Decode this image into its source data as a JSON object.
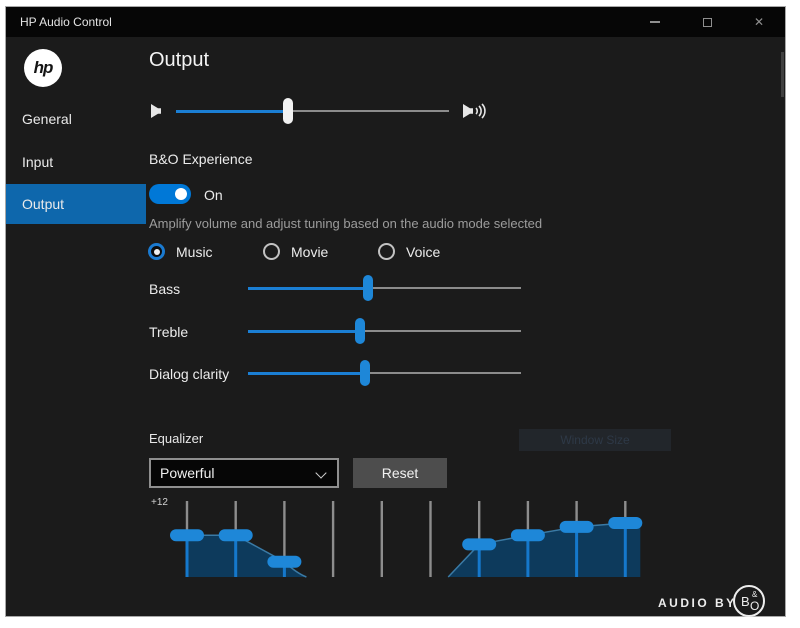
{
  "colors": {
    "accent": "#1578cc",
    "slider_blue": "#1b7fd4",
    "sidebar_selected": "#0e67ac",
    "toggle_on": "#0078d7",
    "eq_fill": "#0d3a5c",
    "eq_curve": "#3a7aa5",
    "eq_handle": "#1e87d8",
    "bar_gray": "#8d8d8d"
  },
  "window": {
    "title": "HP Audio Control",
    "icons": {
      "minimize_icon": "thin-dash",
      "maximize_icon": "square-outline",
      "close_icon": "✕"
    }
  },
  "sidebar": {
    "logo_text": "hp",
    "items": [
      {
        "label": "General",
        "selected": false
      },
      {
        "label": "Input",
        "selected": false
      },
      {
        "label": "Output",
        "selected": true
      }
    ]
  },
  "main": {
    "heading": "Output",
    "volume": {
      "value_pct": 41,
      "left_icon": "speaker-mute-icon",
      "right_icon": "speaker-loud-icon"
    },
    "bo_experience": {
      "label": "B&O Experience",
      "toggle_state": "On",
      "description": "Amplify volume and adjust tuning based on the audio mode selected",
      "modes": [
        {
          "label": "Music",
          "selected": true
        },
        {
          "label": "Movie",
          "selected": false
        },
        {
          "label": "Voice",
          "selected": false
        }
      ]
    },
    "sliders": [
      {
        "label": "Bass",
        "value_pct": 44
      },
      {
        "label": "Treble",
        "value_pct": 41
      },
      {
        "label": "Dialog clarity",
        "value_pct": 43
      }
    ],
    "equalizer": {
      "label": "Equalizer",
      "preset": "Powerful",
      "reset_label": "Reset",
      "ghost_button_label": "Window Size",
      "scale_top_label": "+12",
      "chart": {
        "type": "area",
        "ylabel_top": "+12",
        "bands": [
          {
            "handle": true,
            "level_pct": 55
          },
          {
            "handle": true,
            "level_pct": 55
          },
          {
            "handle": true,
            "level_pct": 20
          },
          {
            "handle": false,
            "level_pct": 0
          },
          {
            "handle": false,
            "level_pct": 0
          },
          {
            "handle": false,
            "level_pct": 0
          },
          {
            "handle": true,
            "level_pct": 43
          },
          {
            "handle": true,
            "level_pct": 55
          },
          {
            "handle": true,
            "level_pct": 66
          },
          {
            "handle": true,
            "level_pct": 71
          }
        ]
      }
    },
    "footer": {
      "audio_by": "AUDIO BY",
      "logo_b": "B",
      "logo_amp": "&",
      "logo_o": "O"
    }
  }
}
